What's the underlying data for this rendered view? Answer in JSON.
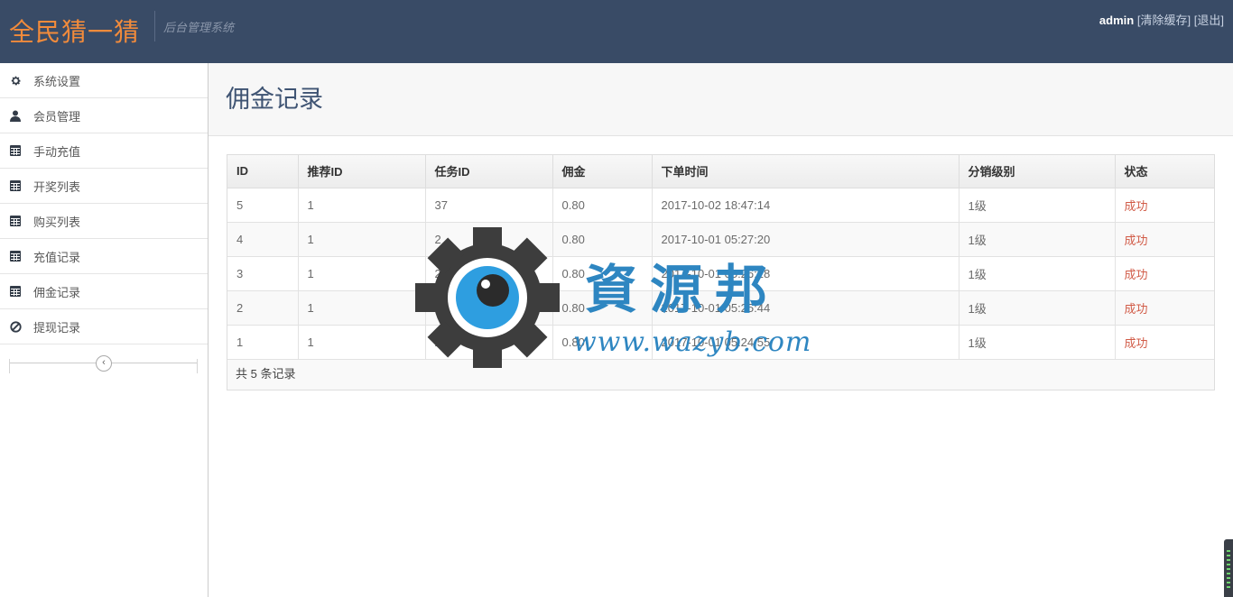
{
  "header": {
    "brand": "全民猜一猜",
    "subtitle": "后台管理系统",
    "user": "admin",
    "clear_cache": "清除缓存",
    "logout": "退出",
    "bracket_open": "[",
    "bracket_close": "]"
  },
  "sidebar": {
    "items": [
      {
        "label": "系统设置",
        "icon": "gear-icon"
      },
      {
        "label": "会员管理",
        "icon": "user-icon"
      },
      {
        "label": "手动充值",
        "icon": "calendar-icon"
      },
      {
        "label": "开奖列表",
        "icon": "calendar-icon"
      },
      {
        "label": "购买列表",
        "icon": "calendar-icon"
      },
      {
        "label": "充值记录",
        "icon": "calendar-icon"
      },
      {
        "label": "佣金记录",
        "icon": "calendar-icon"
      },
      {
        "label": "提现记录",
        "icon": "ban-icon"
      }
    ],
    "collapse_glyph": "‹"
  },
  "main": {
    "title": "佣金记录",
    "table": {
      "columns": [
        "ID",
        "推荐ID",
        "任务ID",
        "佣金",
        "下单时间",
        "分销级别",
        "状态"
      ],
      "rows": [
        [
          "5",
          "1",
          "37",
          "0.80",
          "2017-10-02 18:47:14",
          "1级",
          "成功"
        ],
        [
          "4",
          "1",
          "2",
          "0.80",
          "2017-10-01 05:27:20",
          "1级",
          "成功"
        ],
        [
          "3",
          "1",
          "2",
          "0.80",
          "2017-10-01 05:26:28",
          "1级",
          "成功"
        ],
        [
          "2",
          "1",
          "2",
          "0.80",
          "2017-10-01 05:25:44",
          "1级",
          "成功"
        ],
        [
          "1",
          "1",
          "2",
          "0.80",
          "2017-10-01 05:24:55",
          "1级",
          "成功"
        ]
      ]
    },
    "footer": "共 5 条记录"
  },
  "watermark": {
    "text": "資源邦",
    "url": "www.wazyb.com"
  },
  "colors": {
    "navbar": "#394b66",
    "brand": "#f28b3b",
    "status_success": "#d15b47",
    "watermark": "#2e86c1"
  }
}
